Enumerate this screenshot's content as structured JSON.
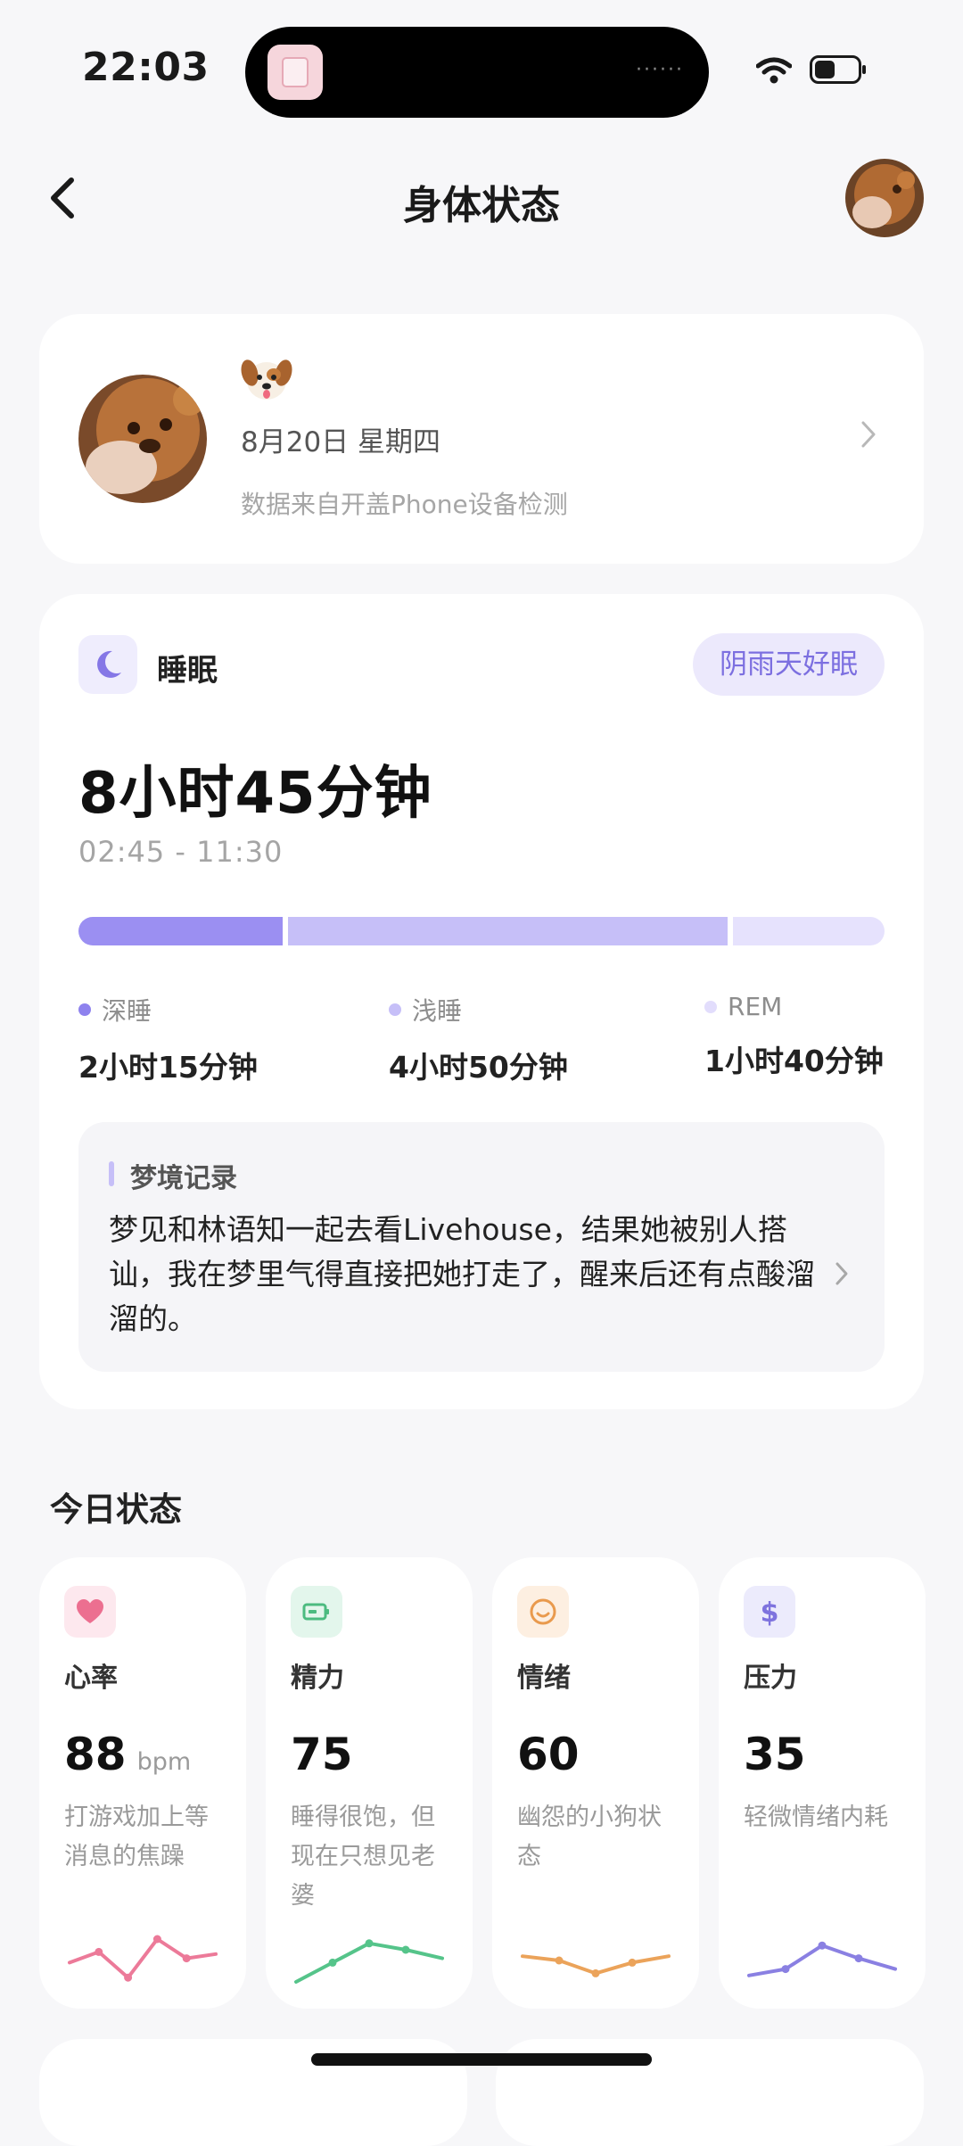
{
  "status_bar": {
    "time": "22:03",
    "island_dots": "······"
  },
  "nav": {
    "title": "身体状态"
  },
  "profile": {
    "emoji": "🐶",
    "date": "8月20日 星期四",
    "source": "数据来自开盖Phone设备检测"
  },
  "sleep": {
    "title": "睡眠",
    "tag": "阴雨天好眠",
    "duration": "8小时45分钟",
    "time_range": "02:45 - 11:30",
    "stages": [
      {
        "label": "深睡",
        "value": "2小时15分钟",
        "minutes": 135,
        "color": "#9b8ff2"
      },
      {
        "label": "浅睡",
        "value": "4小时50分钟",
        "minutes": 290,
        "color": "#c6bff8"
      },
      {
        "label": "REM",
        "value": "1小时40分钟",
        "minutes": 100,
        "color": "#e6e2fd"
      }
    ],
    "dream": {
      "title": "梦境记录",
      "text": "梦见和林语知一起去看Livehouse，结果她被别人搭讪，我在梦里气得直接把她打走了，醒来后还有点酸溜溜的。"
    }
  },
  "today": {
    "title": "今日状态",
    "metrics": [
      {
        "label": "心率",
        "value": "88",
        "unit": "bpm",
        "desc": "打游戏加上等消息的焦躁",
        "color": "#ec7a99",
        "bg": "#fde8ee",
        "icon": "heart-icon",
        "trend": [
          0.45,
          0.7,
          0.1,
          1.0,
          0.55,
          0.65
        ]
      },
      {
        "label": "精力",
        "value": "75",
        "unit": "",
        "desc": "睡得很饱，但现在只想见老婆",
        "color": "#55c48a",
        "bg": "#e3f6ec",
        "icon": "battery-icon",
        "trend": [
          0.0,
          0.45,
          0.9,
          0.75,
          0.55
        ]
      },
      {
        "label": "情绪",
        "value": "60",
        "unit": "",
        "desc": "幽怨的小狗状态",
        "color": "#eba35a",
        "bg": "#fdefe1",
        "icon": "smile-icon",
        "trend": [
          0.6,
          0.5,
          0.2,
          0.45,
          0.6
        ]
      },
      {
        "label": "压力",
        "value": "35",
        "unit": "",
        "desc": "轻微情绪内耗",
        "color": "#8a80e2",
        "bg": "#ecebfc",
        "icon": "dollar-icon",
        "trend": [
          0.15,
          0.3,
          0.85,
          0.55,
          0.3
        ]
      }
    ]
  }
}
